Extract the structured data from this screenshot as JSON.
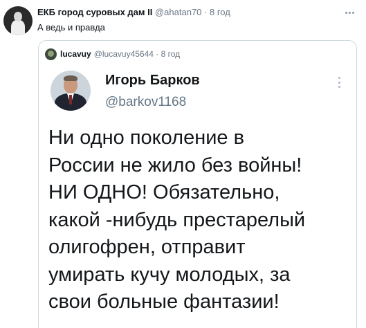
{
  "tweet": {
    "author_name": "ЕКБ город суровых дам II",
    "author_handle": "@ahatan70",
    "separator": "·",
    "time": "8 год",
    "text": "А ведь и правда"
  },
  "quoted": {
    "author_name": "lucavuy",
    "author_handle": "@lucavuy45644",
    "separator": "·",
    "time": "8 год",
    "screenshot": {
      "name": "Игорь Барков",
      "handle": "@barkov1168",
      "lines": [
        "Ни одно поколение в",
        "России не жило без войны!",
        "НИ ОДНО! Обязательно,",
        "какой -нибудь престарелый",
        "олигофрен, отправит",
        "умирать кучу молодых, за",
        "свои больные фантазии!"
      ]
    }
  },
  "icons": {
    "more": "more-horizontal-icon",
    "more_vertical": "more-vertical-icon"
  },
  "colors": {
    "secondary_text": "#687684",
    "border": "#cfd9de"
  }
}
